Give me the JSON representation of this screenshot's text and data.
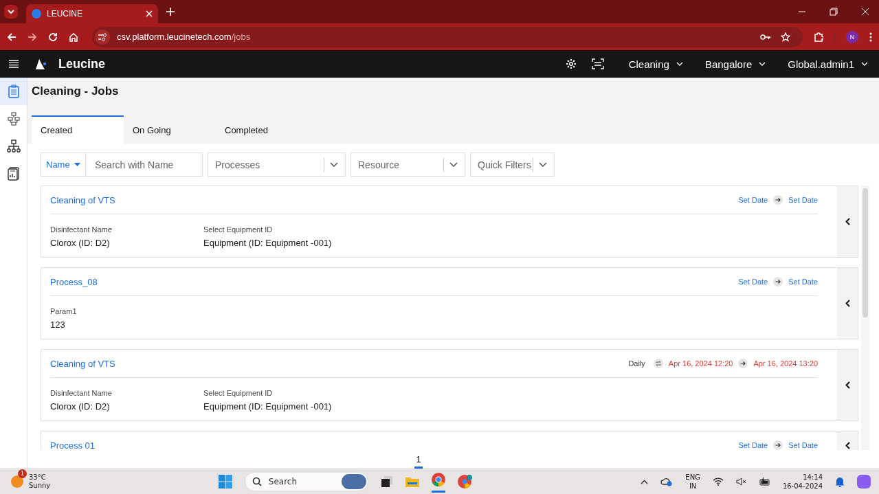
{
  "browser": {
    "tab_title": "LEUCINE",
    "url_host": "csv.platform.leucinetech.com",
    "url_path": "/jobs",
    "profile_initial": "N"
  },
  "app": {
    "brand": "Leucine",
    "header_menus": [
      {
        "label": "Cleaning"
      },
      {
        "label": "Bangalore"
      },
      {
        "label": "Global.admin1"
      }
    ]
  },
  "sidebar_items": [
    {
      "selected": true
    },
    {
      "selected": false
    },
    {
      "selected": false
    },
    {
      "selected": false
    }
  ],
  "page_title": "Cleaning - Jobs",
  "tabs": [
    {
      "label": "Created",
      "selected": true
    },
    {
      "label": "On Going",
      "selected": false
    },
    {
      "label": "Completed",
      "selected": false
    }
  ],
  "filters": {
    "search_by": "Name",
    "search": {
      "placeholder": "Search with Name"
    },
    "dropdowns": [
      {
        "placeholder": "Processes"
      },
      {
        "placeholder": "Resource"
      },
      {
        "placeholder": "Quick Filters"
      }
    ]
  },
  "jobs": [
    {
      "title": "Cleaning of VTS",
      "schedule": {
        "start": "Set Date",
        "end": "Set Date",
        "overdue": false
      },
      "fields": [
        {
          "label": "Disinfectant Name",
          "value": "Clorox (ID: D2)"
        },
        {
          "label": "Select Equipment ID",
          "value": "Equipment (ID: Equipment -001)"
        }
      ]
    },
    {
      "title": "Process_08",
      "schedule": {
        "start": "Set Date",
        "end": "Set Date",
        "overdue": false
      },
      "fields": [
        {
          "label": "Param1",
          "value": "123"
        }
      ]
    },
    {
      "title": "Cleaning of VTS",
      "schedule": {
        "frequency": "Daily",
        "start": "Apr 16, 2024 12:20",
        "end": "Apr 16, 2024 13:20",
        "overdue": true
      },
      "fields": [
        {
          "label": "Disinfectant Name",
          "value": "Clorox (ID: D2)"
        },
        {
          "label": "Select Equipment ID",
          "value": "Equipment (ID: Equipment -001)"
        }
      ]
    },
    {
      "title": "Process 01",
      "schedule": {
        "start": "Set Date",
        "end": "Set Date",
        "overdue": false
      }
    }
  ],
  "pagination": [
    {
      "label": "1",
      "selected": true
    }
  ],
  "taskbar": {
    "weather": {
      "badge": "1",
      "temperature": "33°C",
      "condition": "Sunny"
    },
    "search": {
      "placeholder": "Search"
    },
    "language": [
      "ENG",
      "IN"
    ],
    "time": "14:14",
    "date": "16-04-2024"
  }
}
